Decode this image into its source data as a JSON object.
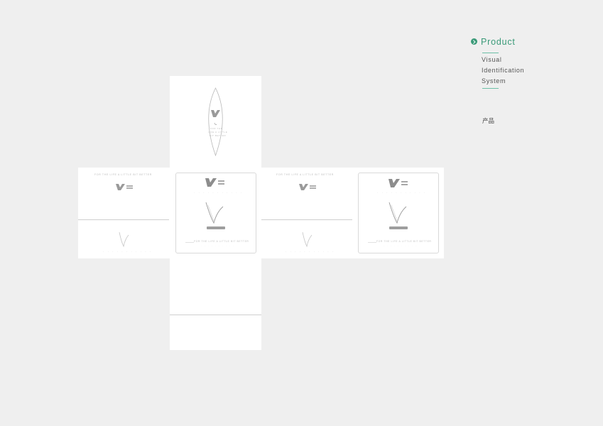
{
  "sidebar": {
    "title": "Product",
    "subtitle_lines": [
      "Visual",
      "Identification",
      "System"
    ],
    "category_label": "产品"
  },
  "packaging": {
    "slogan": "FOR THE LIFE A LITTLE BIT BETTER",
    "diamond_text": [
      "FOR THE",
      "LIFE A LITTLE",
      "BIT BETTER"
    ]
  },
  "colors": {
    "accent": "#3a9a78",
    "background": "#efefef",
    "sheet": "#ffffff"
  }
}
